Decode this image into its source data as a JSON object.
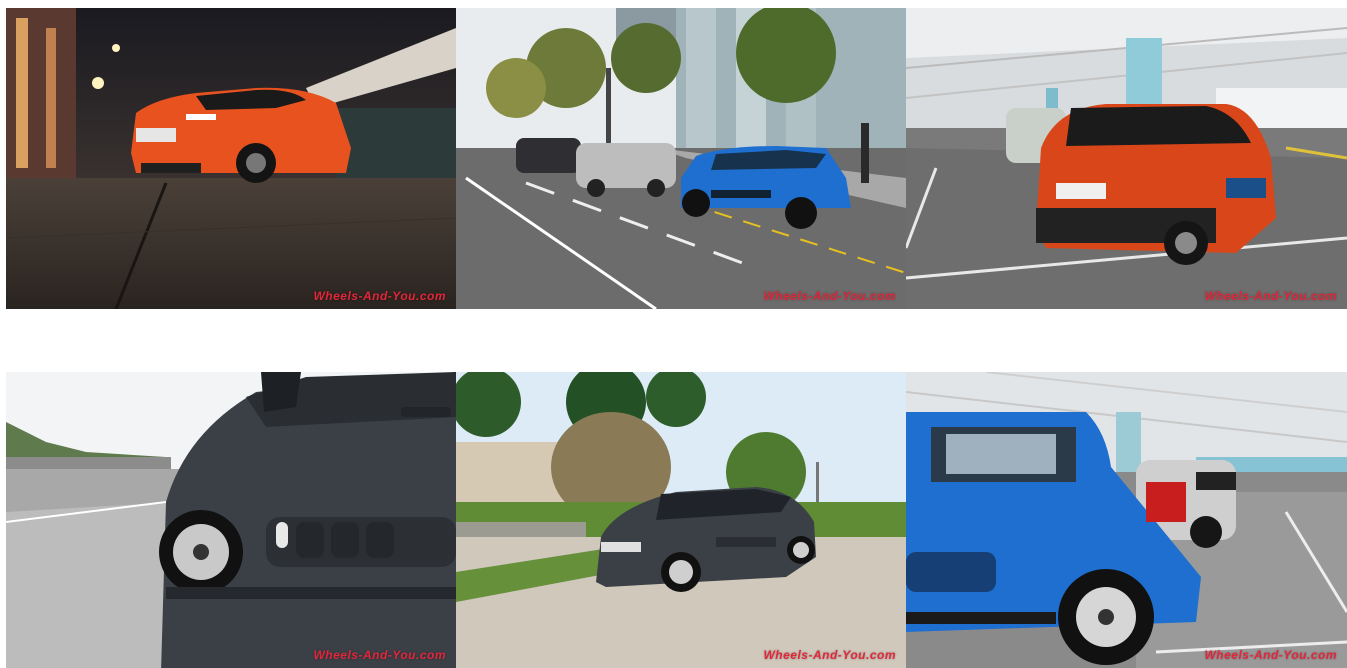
{
  "gallery": {
    "watermark_text": "Wheels-And-You.com",
    "photos": [
      {
        "name": "orange-c3-night-street"
      },
      {
        "name": "blue-c3-parked-street"
      },
      {
        "name": "orange-c3-parking-garage-rear"
      },
      {
        "name": "grey-c3-door-airbump-closeup"
      },
      {
        "name": "grey-c3-garden-driveway"
      },
      {
        "name": "blue-c3-parking-garage-side"
      }
    ]
  },
  "colors": {
    "watermark": "#e3263a",
    "car_orange": "#e8521e",
    "car_blue": "#1e6fd0",
    "car_grey": "#3b4047"
  }
}
